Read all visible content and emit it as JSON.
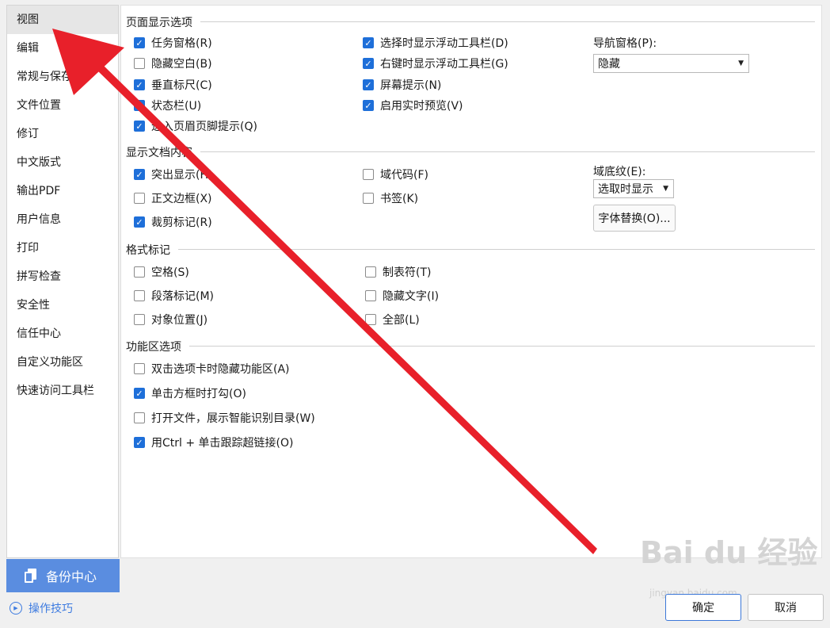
{
  "sidebar": {
    "items": [
      "视图",
      "编辑",
      "常规与保存",
      "文件位置",
      "修订",
      "中文版式",
      "输出PDF",
      "用户信息",
      "打印",
      "拼写检查",
      "安全性",
      "信任中心",
      "自定义功能区",
      "快速访问工具栏"
    ]
  },
  "backup": {
    "label": "备份中心",
    "icon": "backup-icon"
  },
  "tips": {
    "label": "操作技巧",
    "icon": "play-circle-icon"
  },
  "sections": {
    "page_display": "页面显示选项",
    "doc_content": "显示文档内容",
    "format_marks": "格式标记",
    "ribbon": "功能区选项"
  },
  "page_display": {
    "col1": [
      {
        "label": "任务窗格(R)",
        "checked": true
      },
      {
        "label": "隐藏空白(B)",
        "checked": false
      },
      {
        "label": "垂直标尺(C)",
        "checked": true
      },
      {
        "label": "状态栏(U)",
        "checked": true
      },
      {
        "label": "进入页眉页脚提示(Q)",
        "checked": true
      }
    ],
    "col2": [
      {
        "label": "选择时显示浮动工具栏(D)",
        "checked": true
      },
      {
        "label": "右键时显示浮动工具栏(G)",
        "checked": true
      },
      {
        "label": "屏幕提示(N)",
        "checked": true
      },
      {
        "label": "启用实时预览(V)",
        "checked": true
      }
    ],
    "nav_label": "导航窗格(P):",
    "nav_value": "隐藏"
  },
  "doc_content": {
    "col1": [
      {
        "label": "突出显示(H)",
        "checked": true
      },
      {
        "label": "正文边框(X)",
        "checked": false
      },
      {
        "label": "裁剪标记(R)",
        "checked": true
      }
    ],
    "col2": [
      {
        "label": "域代码(F)",
        "checked": false
      },
      {
        "label": "书签(K)",
        "checked": false
      }
    ],
    "shading_label": "域底纹(E):",
    "shading_value": "选取时显示",
    "font_sub_button": "字体替换(O)..."
  },
  "format_marks": {
    "col1": [
      {
        "label": "空格(S)",
        "checked": false
      },
      {
        "label": "段落标记(M)",
        "checked": false
      },
      {
        "label": "对象位置(J)",
        "checked": false
      }
    ],
    "col2": [
      {
        "label": "制表符(T)",
        "checked": false
      },
      {
        "label": "隐藏文字(I)",
        "checked": false
      },
      {
        "label": "全部(L)",
        "checked": false
      }
    ]
  },
  "ribbon": {
    "items": [
      {
        "label": "双击选项卡时隐藏功能区(A)",
        "checked": false
      },
      {
        "label": "单击方框时打勾(O)",
        "checked": true
      },
      {
        "label": "打开文件，展示智能识别目录(W)",
        "checked": false
      },
      {
        "label": "用Ctrl + 单击跟踪超链接(O)",
        "checked": true
      }
    ]
  },
  "footer": {
    "ok": "确定",
    "cancel": "取消"
  },
  "watermark": {
    "main": "Bai du 经验",
    "sub": "jingyan.baidu.com"
  },
  "colors": {
    "accent": "#1e6fd9",
    "arrow": "#e8202a",
    "backup_bg": "#5a8de0"
  }
}
